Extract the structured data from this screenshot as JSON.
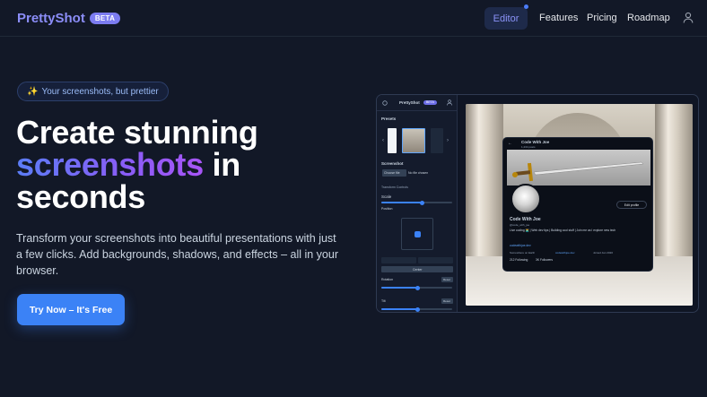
{
  "brand": {
    "name": "PrettyShot",
    "badge": "BETA"
  },
  "nav": {
    "editor": "Editor",
    "links": [
      "Features",
      "Pricing",
      "Roadmap"
    ]
  },
  "hero": {
    "pill_icon": "✨",
    "pill_text": "Your screenshots, but prettier",
    "headline_line1": "Create stunning",
    "headline_highlight": "screenshots",
    "headline_in": " in",
    "headline_line3": "seconds",
    "subtitle": "Transform your screenshots into beautiful presentations with just a few clicks. Add backgrounds, shadows, and effects – all in your browser.",
    "cta": "Try Now – It's Free"
  },
  "preview": {
    "app_name": "PrettyShot",
    "badge": "BETA",
    "presets_label": "Presets",
    "screenshot_label": "Screenshot",
    "tab_a": "Choose file",
    "tab_b": "No file chosen",
    "transform_label": "Transform Controls",
    "scale_label": "Scale",
    "position_label": "Position",
    "center_button": "Center",
    "rotation_label": "Rotation",
    "reset_label": "Reset",
    "tilt_label": "Tilt",
    "colors": {
      "accent": "#3b82f6",
      "brand": "#8b8df7",
      "background": "#121827"
    },
    "profile": {
      "name": "Code With Joe",
      "posts": "1,234 posts",
      "handle": "@code_with_joe",
      "bio": "Live coding 👨‍💻 | Web dev tips | Building cool stuff | Join me as I explore new tech",
      "link": "codewithjoe.dev",
      "meta_location": "Somewhere on Earth",
      "meta_site": "codewithjoe.dev",
      "meta_joined": "Joined Jan 2020",
      "following": "212 Following",
      "followers": "3K Followers",
      "edit_button": "Edit profile"
    }
  }
}
